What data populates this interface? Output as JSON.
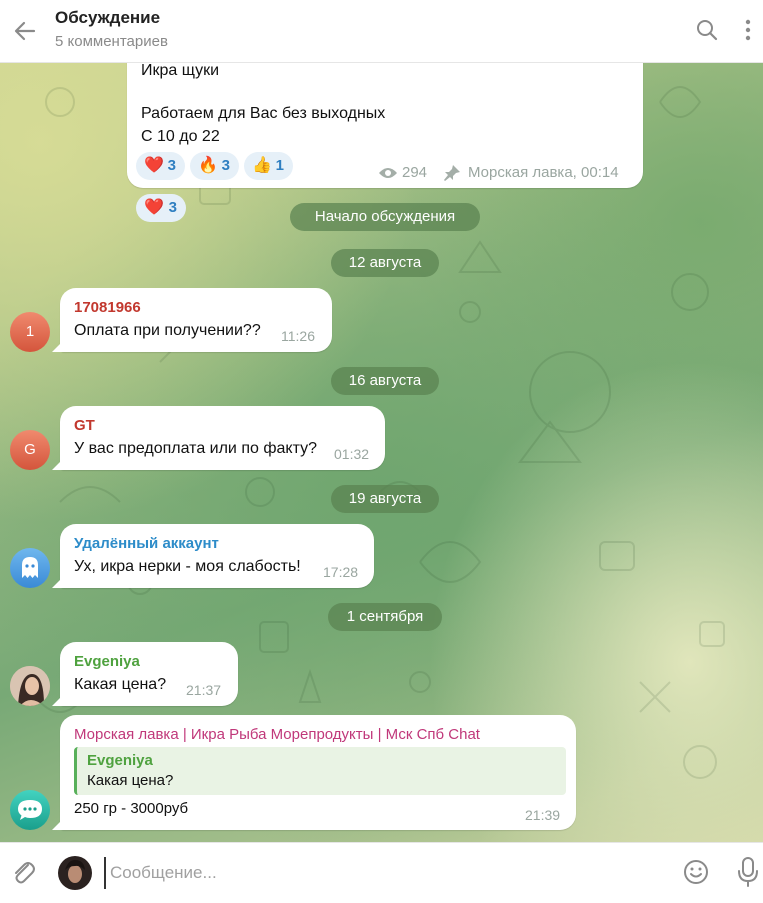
{
  "header": {
    "title": "Обсуждение",
    "subtitle": "5 комментариев",
    "back_icon": "arrow-left-icon",
    "search_icon": "search-icon",
    "more_icon": "more-vertical-icon"
  },
  "post": {
    "lines": [
      "Икра щуки",
      "Работаем для Вас без выходных",
      "С 10 до 22"
    ],
    "reactions": [
      {
        "emoji": "❤️",
        "count": "3"
      },
      {
        "emoji": "🔥",
        "count": "3"
      },
      {
        "emoji": "👍",
        "count": "1"
      }
    ],
    "views": "294",
    "signature": "Морская лавка, 00:14"
  },
  "service": {
    "discussion_start": "Начало обсуждения",
    "dates": [
      "12 августа",
      "16 августа",
      "19 августа",
      "1 сентября"
    ]
  },
  "messages": [
    {
      "author": "17081966",
      "avatar_letter": "1",
      "text": "Оплата при получении??",
      "time": "11:26"
    },
    {
      "author": "GT",
      "avatar_letter": "G",
      "text": "У вас предоплата или по факту?",
      "time": "01:32"
    },
    {
      "author": "Удалённый аккаунт",
      "text": "Ух, икра нерки - моя слабость!",
      "time": "17:28"
    },
    {
      "author": "Evgeniya",
      "text": "Какая цена?",
      "time": "21:37"
    },
    {
      "author": "Морская лавка | Икра Рыба Морепродукты | Мск Спб Chat",
      "reply_author": "Evgeniya",
      "reply_text": "Какая цена?",
      "text": "250 гр - 3000руб",
      "time": "21:39"
    }
  ],
  "composer": {
    "placeholder": "Сообщение..."
  },
  "colors": {
    "accent": "#2f7fc1",
    "author_red": "#c2382e",
    "author_blue": "#2d8cc9",
    "author_green": "#4fa23f",
    "author_magenta": "#c0387a",
    "pill_bg": "#5a8250"
  }
}
